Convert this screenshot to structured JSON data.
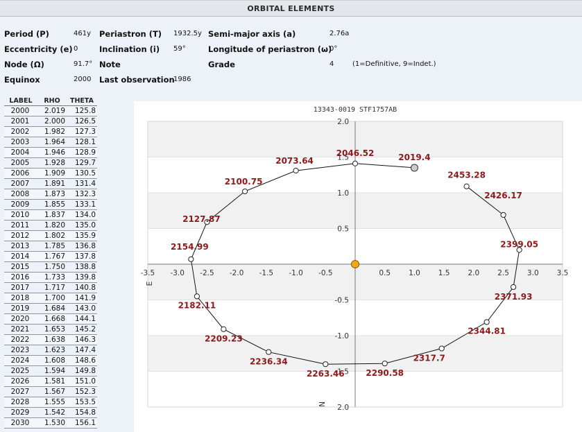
{
  "header": {
    "title": "ORBITAL ELEMENTS"
  },
  "elements": {
    "period_label": "Period (P)",
    "period_value": "461y",
    "periastron_label": "Periastron (T)",
    "periastron_value": "1932.5y",
    "semimajor_label": "Semi-major axis (a)",
    "semimajor_value": "2.76a",
    "ecc_label": "Eccentricity (e)",
    "ecc_value": "0",
    "incl_label": "Inclination (i)",
    "incl_value": "59°",
    "longperi_label": "Longitude of periastron (ω)",
    "longperi_value": "0°",
    "node_label": "Node (Ω)",
    "node_value": "91.7°",
    "note_label": "Note",
    "grade_label": "Grade",
    "grade_value": "4",
    "grade_note": "(1=Definitive, 9=Indet.)",
    "equinox_label": "Equinox",
    "equinox_value": "2000",
    "lastobs_label": "Last observation",
    "lastobs_value": "1986"
  },
  "ephemeris": {
    "headers": [
      "LABEL",
      "RHO",
      "THETA"
    ],
    "rows": [
      [
        "2000",
        "2.019",
        "125.8"
      ],
      [
        "2001",
        "2.000",
        "126.5"
      ],
      [
        "2002",
        "1.982",
        "127.3"
      ],
      [
        "2003",
        "1.964",
        "128.1"
      ],
      [
        "2004",
        "1.946",
        "128.9"
      ],
      [
        "2005",
        "1.928",
        "129.7"
      ],
      [
        "2006",
        "1.909",
        "130.5"
      ],
      [
        "2007",
        "1.891",
        "131.4"
      ],
      [
        "2008",
        "1.873",
        "132.3"
      ],
      [
        "2009",
        "1.855",
        "133.1"
      ],
      [
        "2010",
        "1.837",
        "134.0"
      ],
      [
        "2011",
        "1.820",
        "135.0"
      ],
      [
        "2012",
        "1.802",
        "135.9"
      ],
      [
        "2013",
        "1.785",
        "136.8"
      ],
      [
        "2014",
        "1.767",
        "137.8"
      ],
      [
        "2015",
        "1.750",
        "138.8"
      ],
      [
        "2016",
        "1.733",
        "139.8"
      ],
      [
        "2017",
        "1.717",
        "140.8"
      ],
      [
        "2018",
        "1.700",
        "141.9"
      ],
      [
        "2019",
        "1.684",
        "143.0"
      ],
      [
        "2020",
        "1.668",
        "144.1"
      ],
      [
        "2021",
        "1.653",
        "145.2"
      ],
      [
        "2022",
        "1.638",
        "146.3"
      ],
      [
        "2023",
        "1.623",
        "147.4"
      ],
      [
        "2024",
        "1.608",
        "148.6"
      ],
      [
        "2025",
        "1.594",
        "149.8"
      ],
      [
        "2026",
        "1.581",
        "151.0"
      ],
      [
        "2027",
        "1.567",
        "152.3"
      ],
      [
        "2028",
        "1.555",
        "153.5"
      ],
      [
        "2029",
        "1.542",
        "154.8"
      ],
      [
        "2030",
        "1.530",
        "156.1"
      ]
    ]
  },
  "chart_data": {
    "type": "line",
    "title": "13343-0019 STF1757AB",
    "xlabel": "E",
    "ylabel": "N",
    "xlim": [
      -3.5,
      3.5
    ],
    "ylim": [
      -2.0,
      2.0
    ],
    "x_ticks": [
      "-3.5",
      "-3.0",
      "-2.5",
      "-2.0",
      "-1.5",
      "-1.0",
      "-0.5",
      "0.5",
      "1.0",
      "1.5",
      "2.0",
      "2.5",
      "3.0",
      "3.5"
    ],
    "y_ticks": [
      "2.0",
      "1.5",
      "1.0",
      "0.5",
      "-0.5",
      "-1.0",
      "-1.5",
      "2.0"
    ],
    "grid": "alternating horizontal bands",
    "primary": {
      "x": 0,
      "y": 0,
      "color": "#f0a81c"
    },
    "current": {
      "label": "2019.4",
      "x": 1.0,
      "y": 1.35,
      "color": "#cccccc"
    },
    "colors": {
      "label": "#8b1a1a",
      "line": "#111111",
      "band": "#f1f1f1"
    },
    "points": [
      {
        "label": "2019.4",
        "x": 1.0,
        "y": 1.35
      },
      {
        "label": "2046.52",
        "x": 0.0,
        "y": 1.41
      },
      {
        "label": "2073.64",
        "x": -1.0,
        "y": 1.31
      },
      {
        "label": "2100.75",
        "x": -1.86,
        "y": 1.02
      },
      {
        "label": "2127.87",
        "x": -2.5,
        "y": 0.59
      },
      {
        "label": "2154.99",
        "x": -2.77,
        "y": 0.07
      },
      {
        "label": "2182.11",
        "x": -2.67,
        "y": -0.45
      },
      {
        "label": "2209.23",
        "x": -2.22,
        "y": -0.91
      },
      {
        "label": "2236.34",
        "x": -1.46,
        "y": -1.23
      },
      {
        "label": "2263.46",
        "x": -0.5,
        "y": -1.4
      },
      {
        "label": "2290.58",
        "x": 0.5,
        "y": -1.39
      },
      {
        "label": "2317.7",
        "x": 1.46,
        "y": -1.18
      },
      {
        "label": "2344.81",
        "x": 2.22,
        "y": -0.81
      },
      {
        "label": "2371.93",
        "x": 2.67,
        "y": -0.32
      },
      {
        "label": "2399.05",
        "x": 2.77,
        "y": 0.2
      },
      {
        "label": "2426.17",
        "x": 2.5,
        "y": 0.69
      },
      {
        "label": "2453.28",
        "x": 1.88,
        "y": 1.09
      }
    ]
  }
}
